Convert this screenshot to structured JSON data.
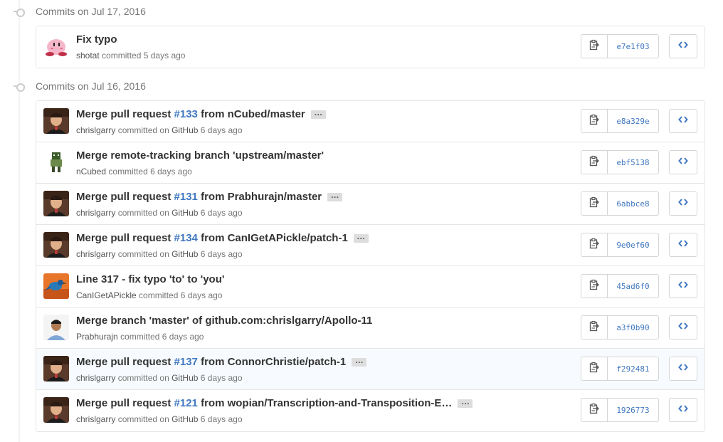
{
  "groups": [
    {
      "date": "Commits on Jul 17, 2016",
      "commits": [
        {
          "title": "Fix typo",
          "pr": "",
          "title_after": "",
          "author": "shotat",
          "via": "",
          "rel_time": "5 days ago",
          "sha": "e7e1f03",
          "avatar": "kirby-avatar",
          "ellipsis": false,
          "highlight": false
        }
      ]
    },
    {
      "date": "Commits on Jul 16, 2016",
      "commits": [
        {
          "title": "Merge pull request ",
          "pr": "#133",
          "title_after": " from nCubed/master",
          "author": "chrislgarry",
          "via": "GitHub",
          "rel_time": "6 days ago",
          "sha": "e8a329e",
          "avatar": "chrislgarry-avatar",
          "ellipsis": true,
          "highlight": false
        },
        {
          "title": "Merge remote-tracking branch 'upstream/master'",
          "pr": "",
          "title_after": "",
          "author": "nCubed",
          "via": "",
          "rel_time": "6 days ago",
          "sha": "ebf5138",
          "avatar": "ncubed-avatar",
          "ellipsis": false,
          "highlight": false
        },
        {
          "title": "Merge pull request ",
          "pr": "#131",
          "title_after": " from Prabhurajn/master",
          "author": "chrislgarry",
          "via": "GitHub",
          "rel_time": "6 days ago",
          "sha": "6abbce8",
          "avatar": "chrislgarry-avatar",
          "ellipsis": true,
          "highlight": false
        },
        {
          "title": "Merge pull request ",
          "pr": "#134",
          "title_after": " from CanIGetAPickle/patch-1",
          "author": "chrislgarry",
          "via": "GitHub",
          "rel_time": "6 days ago",
          "sha": "9e0ef60",
          "avatar": "chrislgarry-avatar",
          "ellipsis": true,
          "highlight": false
        },
        {
          "title": "Line 317 - fix typo 'to' to 'you'",
          "pr": "",
          "title_after": "",
          "author": "CanIGetAPickle",
          "via": "",
          "rel_time": "6 days ago",
          "sha": "45ad6f0",
          "avatar": "bird-avatar",
          "ellipsis": false,
          "highlight": false
        },
        {
          "title": "Merge branch 'master' of github.com:chrislgarry/Apollo-11",
          "pr": "",
          "title_after": "",
          "author": "Prabhurajn",
          "via": "",
          "rel_time": "6 days ago",
          "sha": "a3f0b90",
          "avatar": "prabhurajn-avatar",
          "ellipsis": false,
          "highlight": false
        },
        {
          "title": "Merge pull request ",
          "pr": "#137",
          "title_after": " from ConnorChristie/patch-1",
          "author": "chrislgarry",
          "via": "GitHub",
          "rel_time": "6 days ago",
          "sha": "f292481",
          "avatar": "chrislgarry-avatar",
          "ellipsis": true,
          "highlight": true
        },
        {
          "title": "Merge pull request ",
          "pr": "#121",
          "title_after": " from wopian/Transcription-and-Transposition-E…",
          "author": "chrislgarry",
          "via": "GitHub",
          "rel_time": "6 days ago",
          "sha": "1926773",
          "avatar": "chrislgarry-avatar",
          "ellipsis": true,
          "highlight": false
        }
      ]
    }
  ],
  "labels": {
    "committed": "committed",
    "on": "on",
    "ellipsis": "…"
  },
  "icons": {
    "copy": "clippy-icon",
    "browse": "code-icon"
  },
  "colors": {
    "link": "#4078c0",
    "muted": "#767676",
    "border": "#e5e5e5"
  }
}
